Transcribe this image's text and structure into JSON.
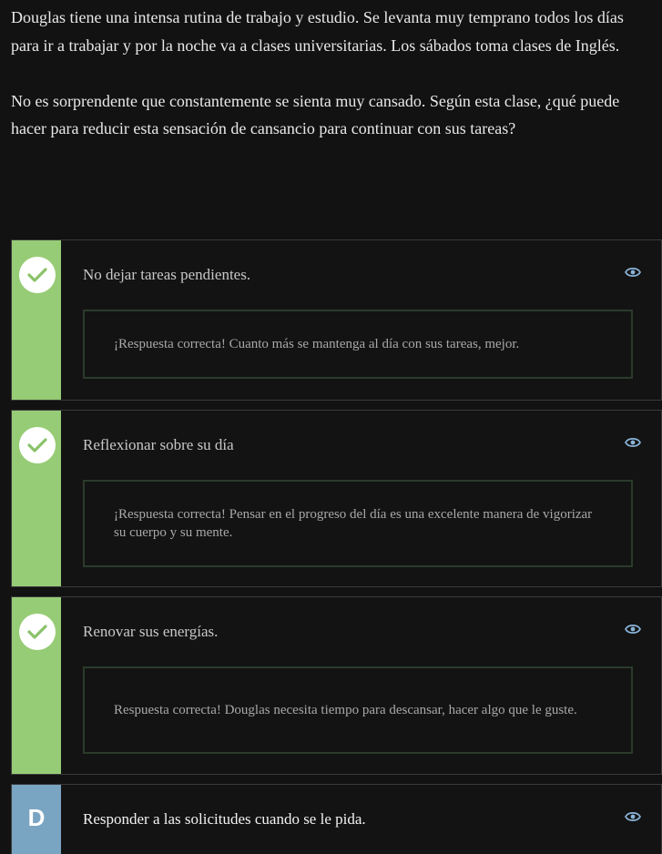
{
  "question": {
    "paragraph1": "Douglas tiene una intensa rutina de trabajo y estudio. Se levanta muy temprano todos los días para ir a trabajar y por la noche va a clases universitarias. Los sábados toma clases de Inglés.",
    "paragraph2": "No es sorprendente que constantemente se sienta muy cansado. Según esta clase, ¿qué puede hacer para reducir esta sensación de cansancio para continuar con sus tareas?"
  },
  "options": [
    {
      "label": "No dejar tareas pendientes.",
      "feedback": "¡Respuesta correcta! Cuanto más se mantenga al día con sus tareas, mejor.",
      "status_icon": "check-icon",
      "state": "correct"
    },
    {
      "label": "Reflexionar sobre su día",
      "feedback": "¡Respuesta correcta! Pensar en el progreso del día es una excelente manera de vigorizar su cuerpo y su mente.",
      "status_icon": "check-icon",
      "state": "correct"
    },
    {
      "label": "Renovar sus energías.",
      "feedback": "Respuesta correcta! Douglas necesita tiempo para descansar, hacer algo que le guste.",
      "status_icon": "check-icon",
      "state": "correct"
    },
    {
      "label": "Responder a las solicitudes cuando se le pida.",
      "letter": "D",
      "status_icon": "none",
      "state": "unselected"
    }
  ],
  "colors": {
    "background": "#121212",
    "correct_strip": "#97cc76",
    "letter_strip": "#7aa5c2",
    "eye_icon": "#8ab4d8",
    "feedback_border": "#2b3b2b"
  }
}
